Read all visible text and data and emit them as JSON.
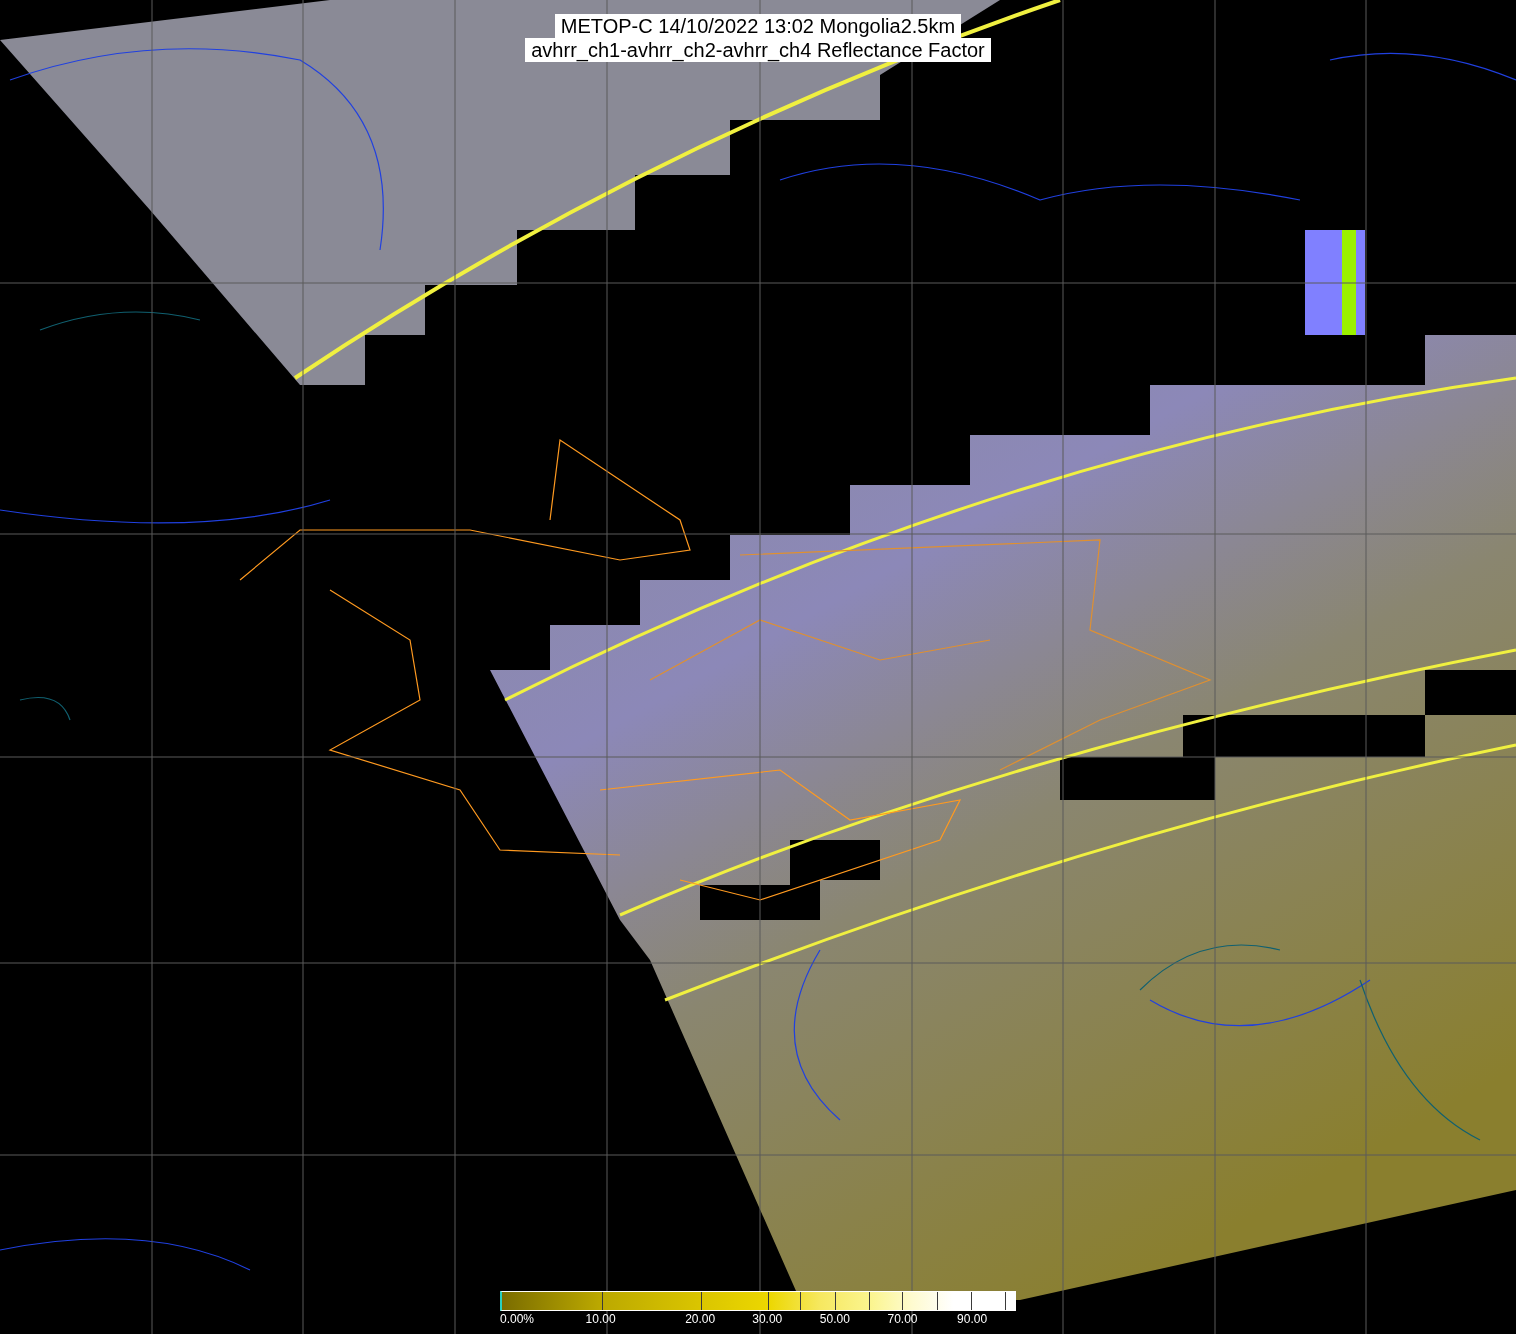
{
  "title_lines": [
    "METOP-C 14/10/2022 13:02 Mongolia2.5km",
    "avhrr_ch1-avhrr_ch2-avhrr_ch4 Reflectance Factor"
  ],
  "colorbar": {
    "labels": [
      "0.00%",
      "10.00",
      "20.00",
      "30.00",
      "50.00",
      "70.00",
      "90.00"
    ]
  }
}
